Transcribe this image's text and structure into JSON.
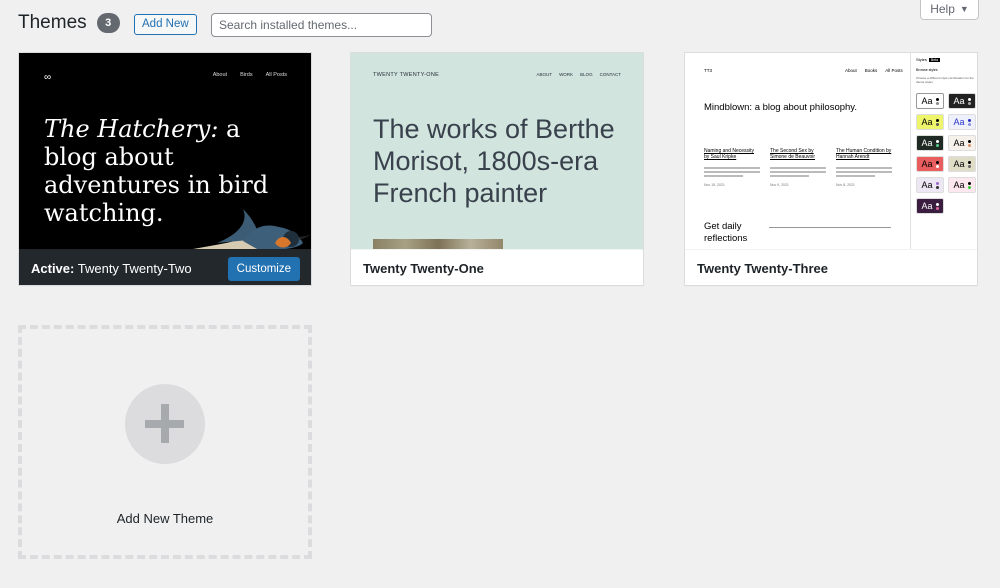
{
  "header": {
    "title": "Themes",
    "count": "3",
    "add_new_label": "Add New",
    "search_placeholder": "Search installed themes...",
    "help_label": "Help"
  },
  "themes": [
    {
      "name": "Twenty Twenty-Two",
      "active_prefix": "Active:",
      "customize_label": "Customize",
      "preview": {
        "nav": [
          "About",
          "Birds",
          "All Posts"
        ],
        "hero_italic": "The Hatchery:",
        "hero_rest": " a blog about adventures in bird watching."
      }
    },
    {
      "name": "Twenty Twenty-One",
      "preview": {
        "site_title": "TWENTY TWENTY-ONE",
        "nav": [
          "ABOUT",
          "WORK",
          "BLOG",
          "CONTACT"
        ],
        "hero": "The works of Berthe Morisot, 1800s-era French painter"
      }
    },
    {
      "name": "Twenty Twenty-Three",
      "preview": {
        "site_name": "TT3",
        "nav": [
          "About",
          "Books",
          "All Posts"
        ],
        "tagline": "Mindblown: a blog about philosophy.",
        "posts": [
          {
            "title": "Naming and Necessity by Saul Kripke",
            "date": "Nov 15, 2021"
          },
          {
            "title": "The Second Sex by Simone de Beauvoir",
            "date": "Nov 9, 2021"
          },
          {
            "title": "The Human Condition by Hannah Arendt",
            "date": "Nov 8, 2021"
          }
        ],
        "subscribe": "Get daily reflections",
        "styles_panel": {
          "title": "Styles",
          "badge": "Beta",
          "browse": "Browse styles",
          "description": "Choose a different style combination for the theme styles",
          "sample": "Aa"
        }
      }
    }
  ],
  "add_theme": {
    "label": "Add New Theme"
  },
  "colors": {
    "accent": "#2271b1",
    "background": "#f0f0f1",
    "active_bar": "#23282d"
  }
}
